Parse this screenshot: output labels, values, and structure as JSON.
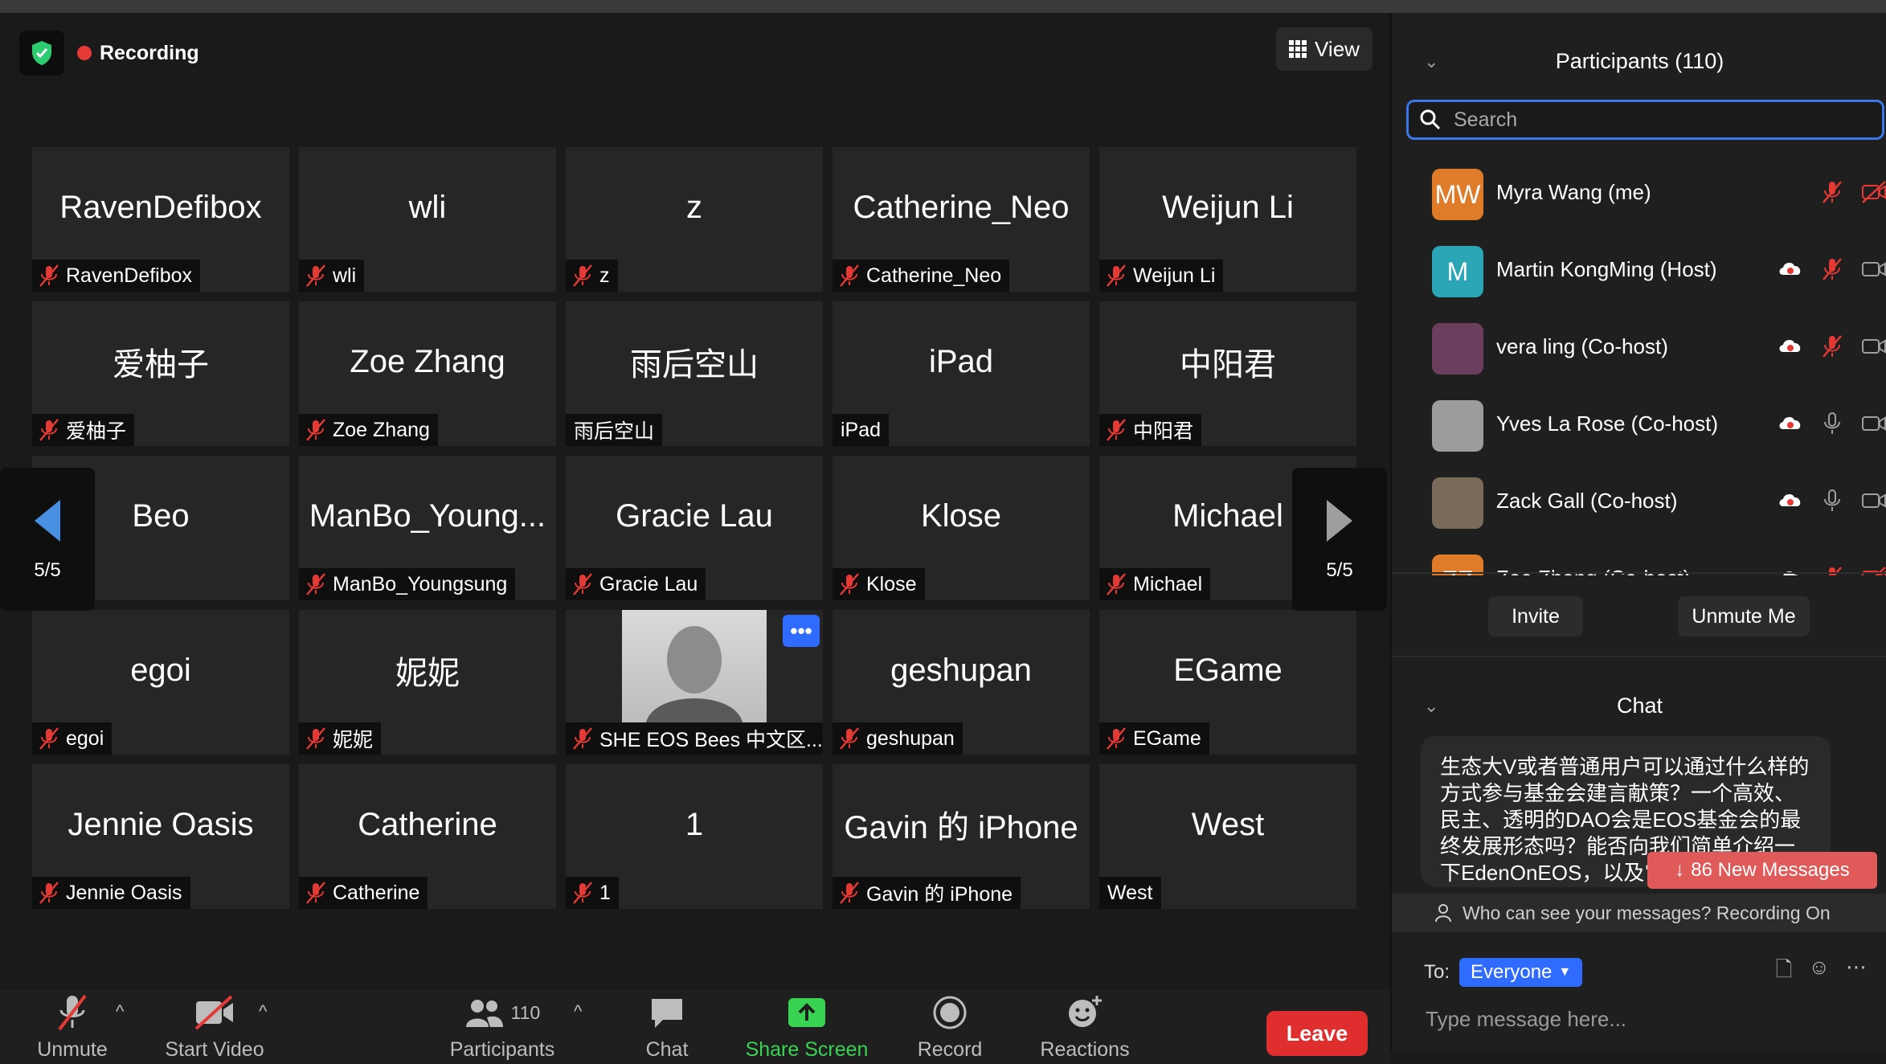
{
  "meeting": {
    "recording_label": "Recording",
    "view_label": "View"
  },
  "tiles": [
    {
      "display": "RavenDefibox",
      "tag": "RavenDefibox",
      "muted": true
    },
    {
      "display": "wli",
      "tag": "wli",
      "muted": true
    },
    {
      "display": "z",
      "tag": "z",
      "muted": true
    },
    {
      "display": "Catherine_Neo",
      "tag": "Catherine_Neo",
      "muted": true
    },
    {
      "display": "Weijun Li",
      "tag": "Weijun Li",
      "muted": true
    },
    {
      "display": "爱柚子",
      "tag": "爱柚子",
      "muted": true
    },
    {
      "display": "Zoe Zhang",
      "tag": "Zoe Zhang",
      "muted": true
    },
    {
      "display": "雨后空山",
      "tag": "雨后空山",
      "muted": false
    },
    {
      "display": "iPad",
      "tag": "iPad",
      "muted": false
    },
    {
      "display": "中阳君",
      "tag": "中阳君",
      "muted": true
    },
    {
      "display": "Beo",
      "tag": "Beo",
      "muted": false
    },
    {
      "display": "ManBo_Young...",
      "tag": "ManBo_Youngsung",
      "muted": true
    },
    {
      "display": "Gracie Lau",
      "tag": "Gracie Lau",
      "muted": true
    },
    {
      "display": "Klose",
      "tag": "Klose",
      "muted": true
    },
    {
      "display": "Michael",
      "tag": "Michael",
      "muted": true
    },
    {
      "display": "egoi",
      "tag": "egoi",
      "muted": true
    },
    {
      "display": "妮妮",
      "tag": "妮妮",
      "muted": true
    },
    {
      "display": "",
      "tag": "SHE EOS Bees 中文区...",
      "muted": true,
      "photo": true
    },
    {
      "display": "geshupan",
      "tag": "geshupan",
      "muted": true
    },
    {
      "display": "EGame",
      "tag": "EGame",
      "muted": true
    },
    {
      "display": "Jennie Oasis",
      "tag": "Jennie Oasis",
      "muted": true
    },
    {
      "display": "Catherine",
      "tag": "Catherine",
      "muted": true
    },
    {
      "display": "1",
      "tag": "1",
      "muted": true
    },
    {
      "display": "Gavin 的 iPhone",
      "tag": "Gavin 的 iPhone",
      "muted": true
    },
    {
      "display": "West",
      "tag": "West",
      "muted": false
    }
  ],
  "pager": {
    "left_label": "5/5",
    "right_label": "5/5"
  },
  "toolbar": {
    "unmute": "Unmute",
    "start_video": "Start Video",
    "participants_count": "110",
    "participants": "Participants",
    "chat": "Chat",
    "share_screen": "Share Screen",
    "record": "Record",
    "reactions": "Reactions",
    "leave": "Leave"
  },
  "panel": {
    "participants_title": "Participants (110)",
    "search_placeholder": "Search",
    "participants": [
      {
        "name": "Myra Wang (me)",
        "initials": "MW",
        "color": "#e07b2a",
        "host_icon": false,
        "mic": "off",
        "video": "off"
      },
      {
        "name": "Martin KongMing (Host)",
        "initials": "M",
        "color": "#2aa6b7",
        "host_icon": true,
        "mic": "off",
        "video": "cam"
      },
      {
        "name": "vera ling (Co-host)",
        "initials": "",
        "color": "#6b3e5d",
        "host_icon": true,
        "mic": "off",
        "video": "cam"
      },
      {
        "name": "Yves La Rose (Co-host)",
        "initials": "",
        "color": "#9c9c9c",
        "host_icon": true,
        "mic": "on",
        "video": "cam"
      },
      {
        "name": "Zack Gall (Co-host)",
        "initials": "",
        "color": "#7a6a5a",
        "host_icon": true,
        "mic": "on",
        "video": "cam"
      },
      {
        "name": "Zoe Zhang (Co-host)",
        "initials": "ZZ",
        "color": "#e07b2a",
        "host_icon": true,
        "mic": "off",
        "video": "off"
      }
    ],
    "invite": "Invite",
    "unmute_me": "Unmute Me",
    "chat_title": "Chat",
    "chat_message": "生态大V或者普通用户可以通过什么样的方式参与基金会建言献策？一个高效、民主、透明的DAO会是EOS基金会的最终发展形态吗？能否向我们简单介绍一下EdenOnEOS，以及它在EOS基金会的运作中将扮演什么样的角色？",
    "new_messages": "86 New Messages",
    "who_can_see": "Who can see your messages? Recording On",
    "to_label": "To:",
    "to_value": "Everyone",
    "message_placeholder": "Type message here..."
  }
}
